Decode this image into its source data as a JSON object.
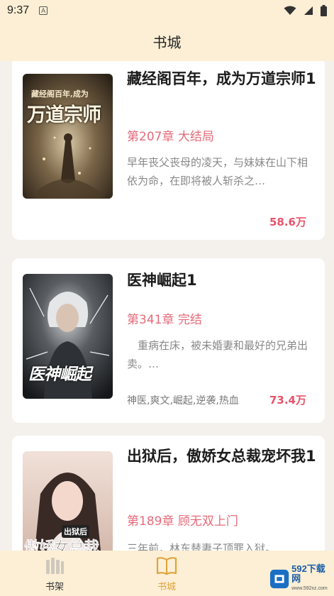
{
  "status_bar": {
    "time": "9:37",
    "notification_letter": "A"
  },
  "header": {
    "title": "书城"
  },
  "books": [
    {
      "title": "藏经阁百年，成为万道宗师1",
      "chapter": "第207章 大结局",
      "description": "早年丧父丧母的凌天，与妹妹在山下相依为命，在即将被人斩杀之…",
      "views": "58.6万",
      "cover_text_main": "万道宗师",
      "cover_text_top": "藏经阁百年,成为"
    },
    {
      "title": "医神崛起1",
      "chapter": "第341章 完结",
      "description": "　重病在床，被未婚妻和最好的兄弟出卖。…",
      "tags": "神医,爽文,崛起,逆袭,热血",
      "views": "73.4万",
      "cover_text_main": "医神崛起"
    },
    {
      "title": "出狱后，傲娇女总裁宠坏我1",
      "chapter": "第189章 顾无双上门",
      "description": "三年前，林东替妻子顶罪入狱。",
      "cover_text_main": "傲娇女总裁",
      "cover_text_top": "出狱后"
    }
  ],
  "tabbar": {
    "shelf_label": "书架",
    "store_label": "书城",
    "active": "store",
    "active_color": "#e0a33e"
  },
  "watermark": {
    "brand": "592下载网",
    "sub": "www.592xz.com"
  }
}
